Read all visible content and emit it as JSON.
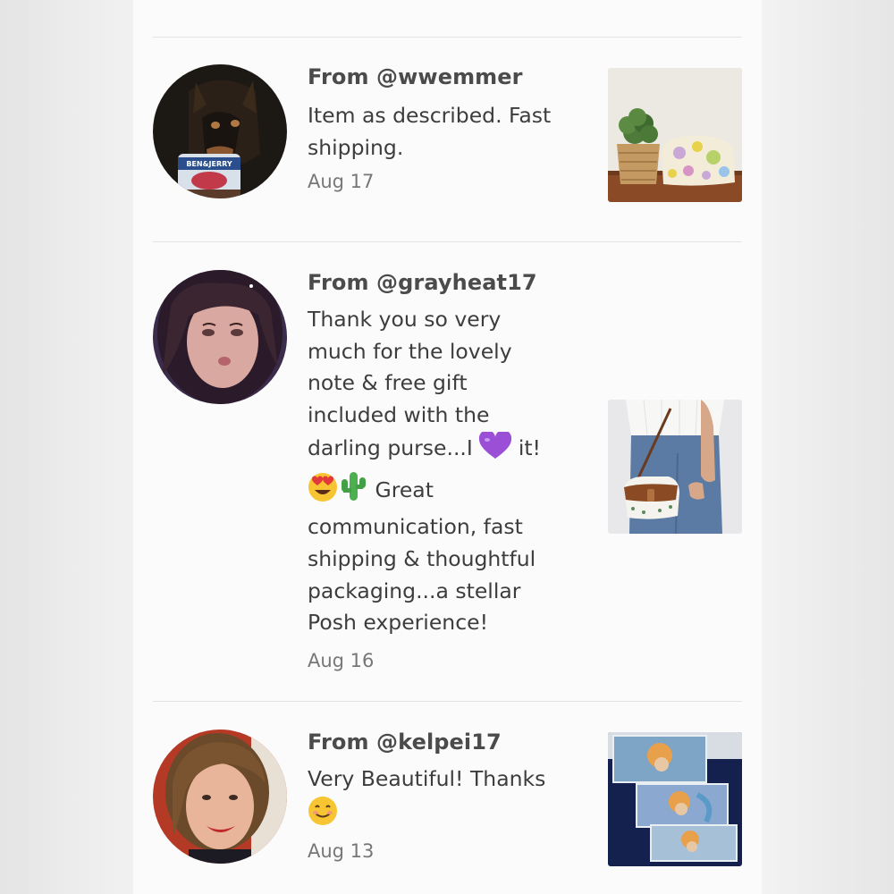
{
  "reviews": [
    {
      "from": "From @wwemmer",
      "comment_lines": [
        "Item as described. Fast",
        "shipping."
      ],
      "date": "Aug 17"
    },
    {
      "from": "From @grayheat17",
      "comment_lines": [
        "Thank you so very",
        "much for the lovely",
        "note & free gift",
        "included with the",
        "darling purse...I",
        "it!",
        "Great",
        "communication, fast",
        "shipping & thoughtful",
        "packaging...a stellar",
        "Posh experience!"
      ],
      "date": "Aug 16",
      "emojis": [
        "purple-heart",
        "heart-eyes",
        "cactus"
      ]
    },
    {
      "from": "From @kelpei17",
      "comment_lines": [
        "Very Beautiful! Thanks"
      ],
      "date": "Aug 13",
      "emojis": [
        "smiling-face"
      ]
    }
  ],
  "colors": {
    "page_background": "#fbfbfc",
    "divider": "#e3e3e6",
    "username_text": "#4b4b4b",
    "comment_text": "#3d3d3d",
    "date_text": "#777777"
  }
}
